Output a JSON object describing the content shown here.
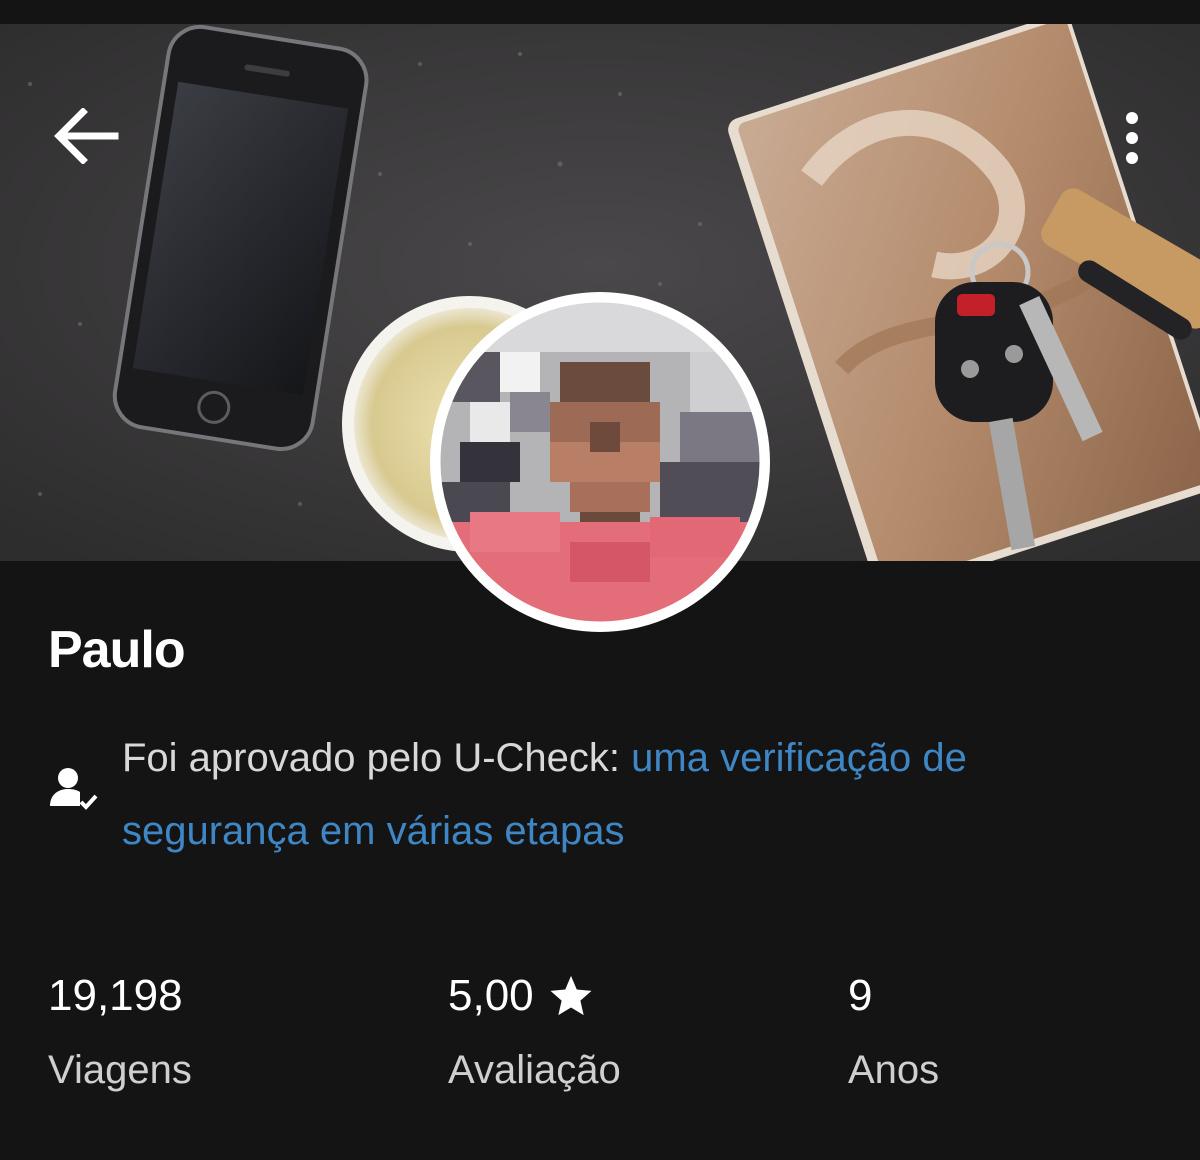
{
  "header": {
    "back_icon": "arrow-left-icon",
    "menu_icon": "more-vertical-icon"
  },
  "driver": {
    "name": "Paulo",
    "photo": "blurred-profile-photo"
  },
  "verification": {
    "icon": "person-check-icon",
    "text": "Foi aprovado pelo U-Check: ",
    "link_text": "uma verificação de segurança em várias etapas"
  },
  "stats": [
    {
      "value": "19,198",
      "label": "Viagens"
    },
    {
      "value": "5,00",
      "label": "Avaliação",
      "icon": "star-icon"
    },
    {
      "value": "9",
      "label": "Anos"
    }
  ],
  "colors": {
    "background": "#141414",
    "link": "#3f86c4",
    "text": "#ffffff",
    "muted": "#cfcfcf"
  }
}
